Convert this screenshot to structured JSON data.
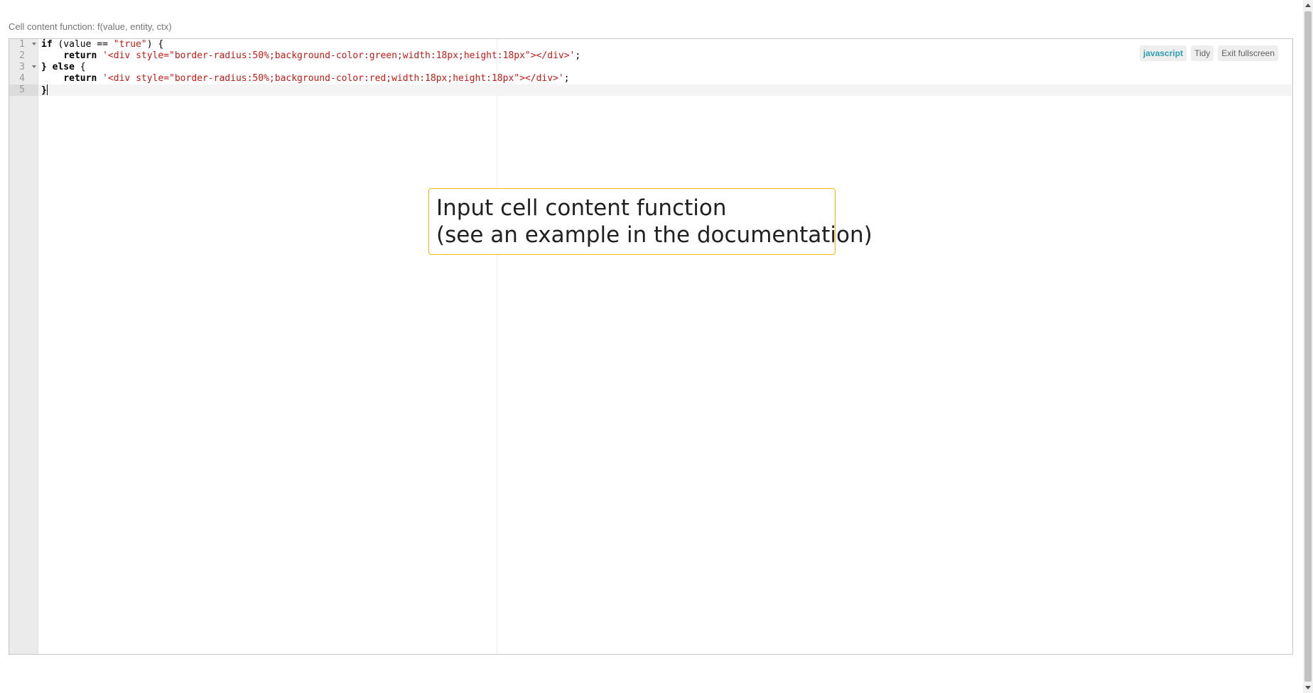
{
  "field": {
    "label": "Cell content function: f(value, entity, ctx)"
  },
  "editor": {
    "toolbar": {
      "mode_label": "javascript",
      "tidy_label": "Tidy",
      "fullscreen_label": "Exit fullscreen"
    },
    "line_numbers": [
      "1",
      "2",
      "3",
      "4",
      "5"
    ],
    "lines": [
      {
        "kw": "if",
        "rest": " (value == ",
        "str": "\"true\"",
        "tail": ") {"
      },
      {
        "indent": "    ",
        "kw": "return",
        "rest": " ",
        "str": "'<div style=\"border-radius:50%;background-color:green;width:18px;height:18px\"></div>'",
        "tail": ";"
      },
      {
        "kw": "} else",
        "rest": " ",
        "str": "",
        "tail": "{"
      },
      {
        "indent": "    ",
        "kw": "return",
        "rest": " ",
        "str": "'<div style=\"border-radius:50%;background-color:red;width:18px;height:18px\"></div>'",
        "tail": ";"
      },
      {
        "kw": "}",
        "rest": "",
        "str": "",
        "tail": ""
      }
    ],
    "placeholder": {
      "line1": "Input cell content function",
      "line2": "(see an example in the documentation)"
    }
  },
  "colors": {
    "mode_accent": "#2b9fb0",
    "placeholder_border": "#f5b800",
    "string": "#c41a16"
  },
  "icons": [
    "fold-arrow-icon",
    "scroll-up-icon",
    "scroll-down-icon"
  ]
}
